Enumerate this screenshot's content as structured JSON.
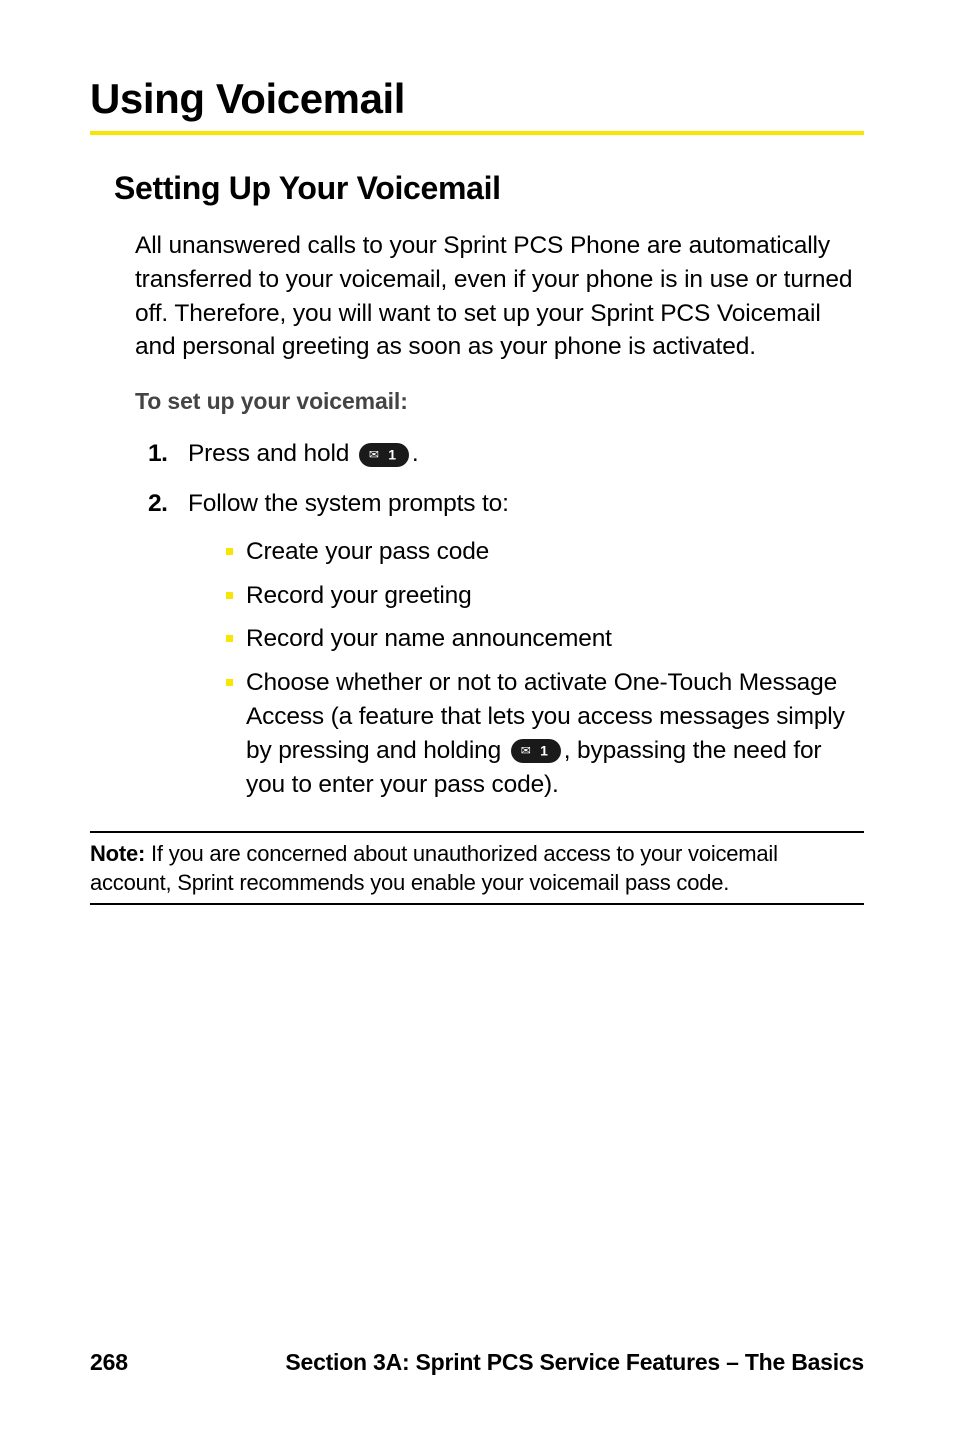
{
  "section_title": "Using Voicemail",
  "subsection_title": "Setting Up Your Voicemail",
  "intro_paragraph": "All unanswered calls to your Sprint PCS Phone are automatically transferred to your voicemail, even if your phone is in use or turned off. Therefore, you will want to set up your Sprint PCS Voicemail and personal greeting as soon as your phone is activated.",
  "setup_heading": "To set up your voicemail:",
  "steps": [
    {
      "num": "1.",
      "prefix": "Press and hold ",
      "suffix": "."
    },
    {
      "num": "2.",
      "text": "Follow the system prompts to:"
    }
  ],
  "sub_items": [
    "Create your pass code",
    "Record your greeting",
    "Record your name announcement"
  ],
  "sub_item_4_part1": "Choose whether or not to activate One-Touch Message Access (a feature that lets you access messages simply by pressing and holding ",
  "sub_item_4_part2": ", bypassing the need for you to enter your pass code).",
  "note_label": "Note: ",
  "note_text": "If you are concerned about unauthorized access to your voicemail account, Sprint recommends you enable your voicemail pass code.",
  "page_number": "268",
  "footer_text": "Section 3A: Sprint PCS Service Features – The Basics"
}
